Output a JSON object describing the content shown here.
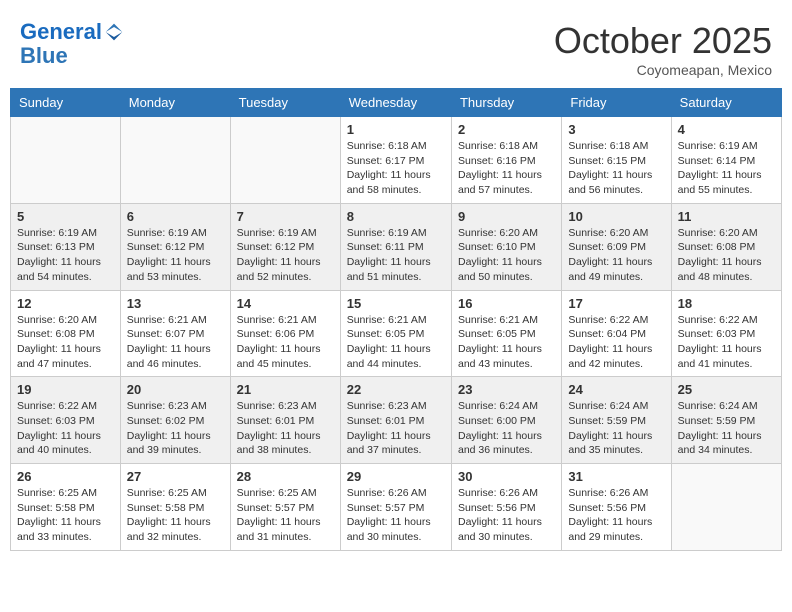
{
  "header": {
    "logo_line1": "General",
    "logo_line2": "Blue",
    "month_title": "October 2025",
    "location": "Coyomeapan, Mexico"
  },
  "days_of_week": [
    "Sunday",
    "Monday",
    "Tuesday",
    "Wednesday",
    "Thursday",
    "Friday",
    "Saturday"
  ],
  "weeks": [
    [
      {
        "num": "",
        "info": ""
      },
      {
        "num": "",
        "info": ""
      },
      {
        "num": "",
        "info": ""
      },
      {
        "num": "1",
        "info": "Sunrise: 6:18 AM\nSunset: 6:17 PM\nDaylight: 11 hours\nand 58 minutes."
      },
      {
        "num": "2",
        "info": "Sunrise: 6:18 AM\nSunset: 6:16 PM\nDaylight: 11 hours\nand 57 minutes."
      },
      {
        "num": "3",
        "info": "Sunrise: 6:18 AM\nSunset: 6:15 PM\nDaylight: 11 hours\nand 56 minutes."
      },
      {
        "num": "4",
        "info": "Sunrise: 6:19 AM\nSunset: 6:14 PM\nDaylight: 11 hours\nand 55 minutes."
      }
    ],
    [
      {
        "num": "5",
        "info": "Sunrise: 6:19 AM\nSunset: 6:13 PM\nDaylight: 11 hours\nand 54 minutes."
      },
      {
        "num": "6",
        "info": "Sunrise: 6:19 AM\nSunset: 6:12 PM\nDaylight: 11 hours\nand 53 minutes."
      },
      {
        "num": "7",
        "info": "Sunrise: 6:19 AM\nSunset: 6:12 PM\nDaylight: 11 hours\nand 52 minutes."
      },
      {
        "num": "8",
        "info": "Sunrise: 6:19 AM\nSunset: 6:11 PM\nDaylight: 11 hours\nand 51 minutes."
      },
      {
        "num": "9",
        "info": "Sunrise: 6:20 AM\nSunset: 6:10 PM\nDaylight: 11 hours\nand 50 minutes."
      },
      {
        "num": "10",
        "info": "Sunrise: 6:20 AM\nSunset: 6:09 PM\nDaylight: 11 hours\nand 49 minutes."
      },
      {
        "num": "11",
        "info": "Sunrise: 6:20 AM\nSunset: 6:08 PM\nDaylight: 11 hours\nand 48 minutes."
      }
    ],
    [
      {
        "num": "12",
        "info": "Sunrise: 6:20 AM\nSunset: 6:08 PM\nDaylight: 11 hours\nand 47 minutes."
      },
      {
        "num": "13",
        "info": "Sunrise: 6:21 AM\nSunset: 6:07 PM\nDaylight: 11 hours\nand 46 minutes."
      },
      {
        "num": "14",
        "info": "Sunrise: 6:21 AM\nSunset: 6:06 PM\nDaylight: 11 hours\nand 45 minutes."
      },
      {
        "num": "15",
        "info": "Sunrise: 6:21 AM\nSunset: 6:05 PM\nDaylight: 11 hours\nand 44 minutes."
      },
      {
        "num": "16",
        "info": "Sunrise: 6:21 AM\nSunset: 6:05 PM\nDaylight: 11 hours\nand 43 minutes."
      },
      {
        "num": "17",
        "info": "Sunrise: 6:22 AM\nSunset: 6:04 PM\nDaylight: 11 hours\nand 42 minutes."
      },
      {
        "num": "18",
        "info": "Sunrise: 6:22 AM\nSunset: 6:03 PM\nDaylight: 11 hours\nand 41 minutes."
      }
    ],
    [
      {
        "num": "19",
        "info": "Sunrise: 6:22 AM\nSunset: 6:03 PM\nDaylight: 11 hours\nand 40 minutes."
      },
      {
        "num": "20",
        "info": "Sunrise: 6:23 AM\nSunset: 6:02 PM\nDaylight: 11 hours\nand 39 minutes."
      },
      {
        "num": "21",
        "info": "Sunrise: 6:23 AM\nSunset: 6:01 PM\nDaylight: 11 hours\nand 38 minutes."
      },
      {
        "num": "22",
        "info": "Sunrise: 6:23 AM\nSunset: 6:01 PM\nDaylight: 11 hours\nand 37 minutes."
      },
      {
        "num": "23",
        "info": "Sunrise: 6:24 AM\nSunset: 6:00 PM\nDaylight: 11 hours\nand 36 minutes."
      },
      {
        "num": "24",
        "info": "Sunrise: 6:24 AM\nSunset: 5:59 PM\nDaylight: 11 hours\nand 35 minutes."
      },
      {
        "num": "25",
        "info": "Sunrise: 6:24 AM\nSunset: 5:59 PM\nDaylight: 11 hours\nand 34 minutes."
      }
    ],
    [
      {
        "num": "26",
        "info": "Sunrise: 6:25 AM\nSunset: 5:58 PM\nDaylight: 11 hours\nand 33 minutes."
      },
      {
        "num": "27",
        "info": "Sunrise: 6:25 AM\nSunset: 5:58 PM\nDaylight: 11 hours\nand 32 minutes."
      },
      {
        "num": "28",
        "info": "Sunrise: 6:25 AM\nSunset: 5:57 PM\nDaylight: 11 hours\nand 31 minutes."
      },
      {
        "num": "29",
        "info": "Sunrise: 6:26 AM\nSunset: 5:57 PM\nDaylight: 11 hours\nand 30 minutes."
      },
      {
        "num": "30",
        "info": "Sunrise: 6:26 AM\nSunset: 5:56 PM\nDaylight: 11 hours\nand 30 minutes."
      },
      {
        "num": "31",
        "info": "Sunrise: 6:26 AM\nSunset: 5:56 PM\nDaylight: 11 hours\nand 29 minutes."
      },
      {
        "num": "",
        "info": ""
      }
    ]
  ]
}
